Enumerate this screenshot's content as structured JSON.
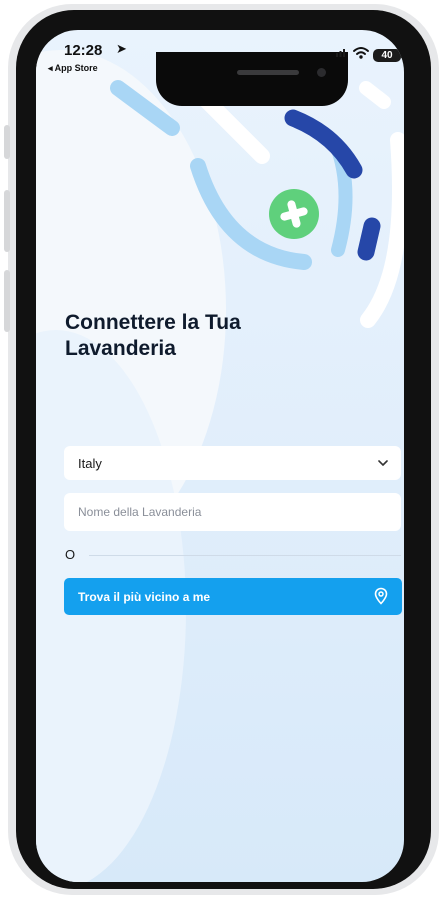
{
  "status_bar": {
    "time": "12:28",
    "location_arrow": "➤",
    "back_app": "◂ App Store",
    "battery": "40"
  },
  "colors": {
    "accent": "#14a0ee",
    "deco_dark": "#2647a8",
    "deco_light": "#a9d6f5",
    "deco_green": "#5fd07c"
  },
  "main": {
    "title_line1": "Connettere la Tua",
    "title_line2": "Lavanderia",
    "country_value": "Italy",
    "laundry_placeholder": "Nome della Lavanderia",
    "or_text": "O",
    "nearest_button_label": "Trova il più vicino a me"
  },
  "icons": {
    "country_dropdown": "chevron-down-icon",
    "nearest_button": "location-pin-icon",
    "logo": "green-plus-logo"
  }
}
